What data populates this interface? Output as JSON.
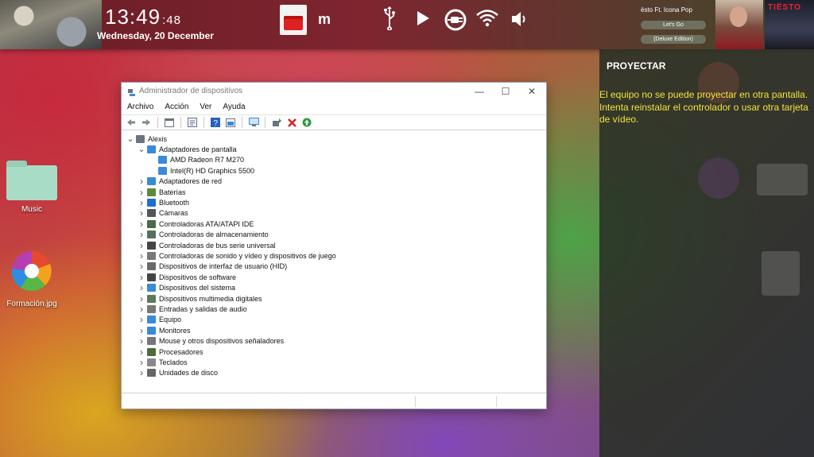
{
  "topbar": {
    "time_hm": "13:49",
    "time_sec": ":48",
    "date": "Wednesday, 20 December",
    "now_playing": {
      "line1": "ësto Ft. Icona Pop",
      "line2": "Let's Go",
      "line3": "(Deluxe Edition)"
    },
    "album2_title": "TIËSTO",
    "icons": [
      "toolbox-icon",
      "maxthon-icon",
      "usb-icon",
      "play-icon",
      "power-plug-icon",
      "wifi-icon",
      "volume-icon"
    ]
  },
  "desktop": {
    "icons": [
      {
        "label": "Music",
        "icon": "folder-icon"
      },
      {
        "label": "Formación.jpg",
        "icon": "image-file-icon"
      }
    ]
  },
  "panel": {
    "title": "PROYECTAR",
    "message": "El equipo no se puede proyectar en otra pantalla. Intenta reinstalar el controlador o usar otra tarjeta de vídeo."
  },
  "window": {
    "title": "Administrador de dispositivos",
    "controls": {
      "minimize": "—",
      "maximize": "☐",
      "close": "✕"
    },
    "menu": [
      "Archivo",
      "Acción",
      "Ver",
      "Ayuda"
    ],
    "tree": [
      {
        "label": "Alexis",
        "level": 0,
        "expanded": true,
        "color": "#6a7380"
      },
      {
        "label": "Adaptadores de pantalla",
        "level": 1,
        "expanded": true,
        "color": "#3a8ad6"
      },
      {
        "label": "AMD Radeon R7 M270",
        "level": 2,
        "leaf": true,
        "color": "#3a8ad6"
      },
      {
        "label": "Intel(R) HD Graphics 5500",
        "level": 2,
        "leaf": true,
        "color": "#3a8ad6"
      },
      {
        "label": "Adaptadores de red",
        "level": 1,
        "color": "#3a8ad6"
      },
      {
        "label": "Baterías",
        "level": 1,
        "color": "#5c8a3c"
      },
      {
        "label": "Bluetooth",
        "level": 1,
        "color": "#1e6fd0"
      },
      {
        "label": "Cámaras",
        "level": 1,
        "color": "#555555"
      },
      {
        "label": "Controladoras ATA/ATAPI IDE",
        "level": 1,
        "color": "#4a6a4a"
      },
      {
        "label": "Controladoras de almacenamiento",
        "level": 1,
        "color": "#5a6e5a"
      },
      {
        "label": "Controladoras de bus serie universal",
        "level": 1,
        "color": "#444444"
      },
      {
        "label": "Controladoras de sonido y vídeo y dispositivos de juego",
        "level": 1,
        "color": "#777777"
      },
      {
        "label": "Dispositivos de interfaz de usuario (HID)",
        "level": 1,
        "color": "#6a6a6a"
      },
      {
        "label": "Dispositivos de software",
        "level": 1,
        "color": "#444444"
      },
      {
        "label": "Dispositivos del sistema",
        "level": 1,
        "color": "#3a8ad6"
      },
      {
        "label": "Dispositivos multimedia digitales",
        "level": 1,
        "color": "#5a7a5a"
      },
      {
        "label": "Entradas y salidas de audio",
        "level": 1,
        "color": "#777777"
      },
      {
        "label": "Equipo",
        "level": 1,
        "color": "#3a8ad6"
      },
      {
        "label": "Monitores",
        "level": 1,
        "color": "#3a8ad6"
      },
      {
        "label": "Mouse y otros dispositivos señaladores",
        "level": 1,
        "color": "#777777"
      },
      {
        "label": "Procesadores",
        "level": 1,
        "color": "#4d6b3a"
      },
      {
        "label": "Teclados",
        "level": 1,
        "color": "#888888"
      },
      {
        "label": "Unidades de disco",
        "level": 1,
        "color": "#666666"
      }
    ]
  }
}
